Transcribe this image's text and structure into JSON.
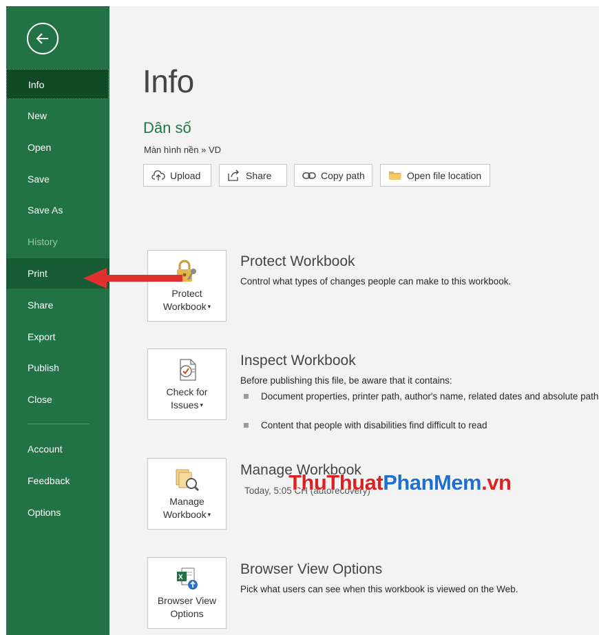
{
  "sidebar": {
    "items": [
      {
        "label": "Info"
      },
      {
        "label": "New"
      },
      {
        "label": "Open"
      },
      {
        "label": "Save"
      },
      {
        "label": "Save As"
      },
      {
        "label": "History"
      },
      {
        "label": "Print"
      },
      {
        "label": "Share"
      },
      {
        "label": "Export"
      },
      {
        "label": "Publish"
      },
      {
        "label": "Close"
      },
      {
        "label": "Account"
      },
      {
        "label": "Feedback"
      },
      {
        "label": "Options"
      }
    ]
  },
  "main": {
    "title": "Info",
    "doc_name": "Dân số",
    "doc_path": "Màn hình nền » VD",
    "actions": {
      "upload": "Upload",
      "share": "Share",
      "copy_path": "Copy path",
      "open_location": "Open file location"
    },
    "protect": {
      "tile_line1": "Protect",
      "tile_line2": "Workbook",
      "title": "Protect Workbook",
      "desc": "Control what types of changes people can make to this workbook."
    },
    "inspect": {
      "tile_line1": "Check for",
      "tile_line2": "Issues",
      "title": "Inspect Workbook",
      "desc": "Before publishing this file, be aware that it contains:",
      "bullets": [
        "Document properties, printer path, author's name, related dates and absolute path",
        "Content that people with disabilities find difficult to read"
      ]
    },
    "manage": {
      "tile_line1": "Manage",
      "tile_line2": "Workbook",
      "title": "Manage Workbook",
      "detail": "Today, 5:05 CH (autorecovery)"
    },
    "browser": {
      "tile_line1": "Browser View",
      "tile_line2": "Options",
      "title": "Browser View Options",
      "desc": "Pick what users can see when this workbook is viewed on the Web."
    }
  },
  "watermark": {
    "part1": "ThuThuat",
    "part2": "PhanMem",
    "part3": ".vn"
  },
  "colors": {
    "sidebar": "#217346",
    "sidebar_active": "#0e4a25",
    "arrow": "#e03030",
    "doc_name": "#217346"
  }
}
